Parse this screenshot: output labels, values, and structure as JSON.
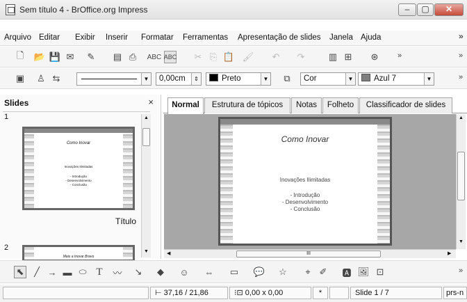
{
  "window": {
    "title": "Sem título 4 - BrOffice.org Impress"
  },
  "menu": [
    "Arquivo",
    "Editar",
    "Exibir",
    "Inserir",
    "Formatar",
    "Ferramentas",
    "Apresentação de slides",
    "Janela",
    "Ajuda"
  ],
  "line_toolbar": {
    "width_value": "0,00cm",
    "line_color": "Preto",
    "area_style": "Cor",
    "area_color": "Azul 7",
    "colors": {
      "black": "#000000",
      "azul7": "#7f7f7f"
    }
  },
  "slides_panel": {
    "title": "Slides",
    "close": "×",
    "slides": [
      {
        "number": "1",
        "heading": "Como Inovar",
        "subtitle": "Inovações Ilimitadas",
        "items": [
          "- Introdução",
          "- Desenvolvimento",
          "- Conclusão"
        ],
        "caption": "Título"
      },
      {
        "number": "2",
        "heading": "Mais a Inovar Bravo"
      }
    ]
  },
  "view_tabs": [
    "Normal",
    "Estrutura de tópicos",
    "Notas",
    "Folheto",
    "Classificador de slides"
  ],
  "current_slide": {
    "heading": "Como Inovar",
    "subtitle": "Inovações Ilimitadas",
    "items": [
      "- Introdução",
      "- Desenvolvimento",
      "- Conclusão"
    ]
  },
  "hscroll_grip": "III",
  "status": {
    "position": "37,16 / 21,86",
    "size": "0,00 x 0,00",
    "modified": "*",
    "slide": "Slide 1 / 7",
    "layout": "prs-n"
  }
}
